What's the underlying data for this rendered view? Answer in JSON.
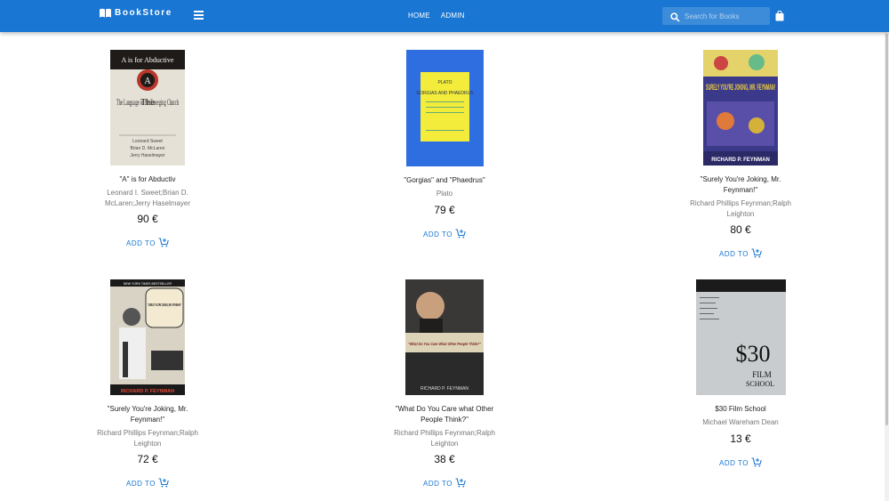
{
  "header": {
    "brand": "BookStore",
    "nav": [
      "HOME",
      "ADMIN"
    ],
    "search_placeholder": "Search for Books",
    "bar_color": "#1976d2"
  },
  "icons": {
    "logo": "book-icon",
    "menu": "menu-icon",
    "search": "search-icon",
    "cart": "shopping-bag-icon",
    "add": "add-shopping-cart-icon"
  },
  "cover_text": {
    "book1": [
      "A is for Abductive",
      "A",
      "The Language of the Emerging Church",
      "Leonard Sweet",
      "Brian D. McLaren",
      "Jerry Haselmayer"
    ],
    "book2": [
      "PLATO",
      "GORGIAS AND PHAEDRUS"
    ],
    "book3": [
      "SURELY YOU'RE JOKING, MR. FEYNMAN!",
      "RICHARD P. FEYNMAN"
    ],
    "book4": [
      "NEW YORK TIMES BESTSELLER",
      "\"SURELY YOU'RE JOKING, MR. FEYNMAN!\"",
      "RICHARD P. FEYNMAN"
    ],
    "book5": [
      "\"What Do You Care What Other People Think?\"",
      "RICHARD P. FEYNMAN"
    ],
    "book6": [
      "$30",
      "FILM",
      "SCHOOL"
    ]
  },
  "add_label": "ADD TO",
  "books": [
    {
      "title": "\"A\" is for Abductiv",
      "authors": "Leonard I. Sweet;Brian D. McLaren;Jerry Haselmayer",
      "price": "90 €"
    },
    {
      "title": "\"Gorgias\" and \"Phaedrus\"",
      "authors": "Plato",
      "price": "79 €"
    },
    {
      "title": "\"Surely You're Joking, Mr. Feynman!\"",
      "authors": "Richard Phillips Feynman;Ralph Leighton",
      "price": "80 €"
    },
    {
      "title": "\"Surely You're Joking, Mr. Feynman!\"",
      "authors": "Richard Phillips Feynman;Ralph Leighton",
      "price": "72 €"
    },
    {
      "title": "\"What Do You Care what Other People Think?\"",
      "authors": "Richard Phillips Feynman;Ralph Leighton",
      "price": "38 €"
    },
    {
      "title": "$30 Film School",
      "authors": "Michael Wareham Dean",
      "price": "13 €"
    }
  ]
}
